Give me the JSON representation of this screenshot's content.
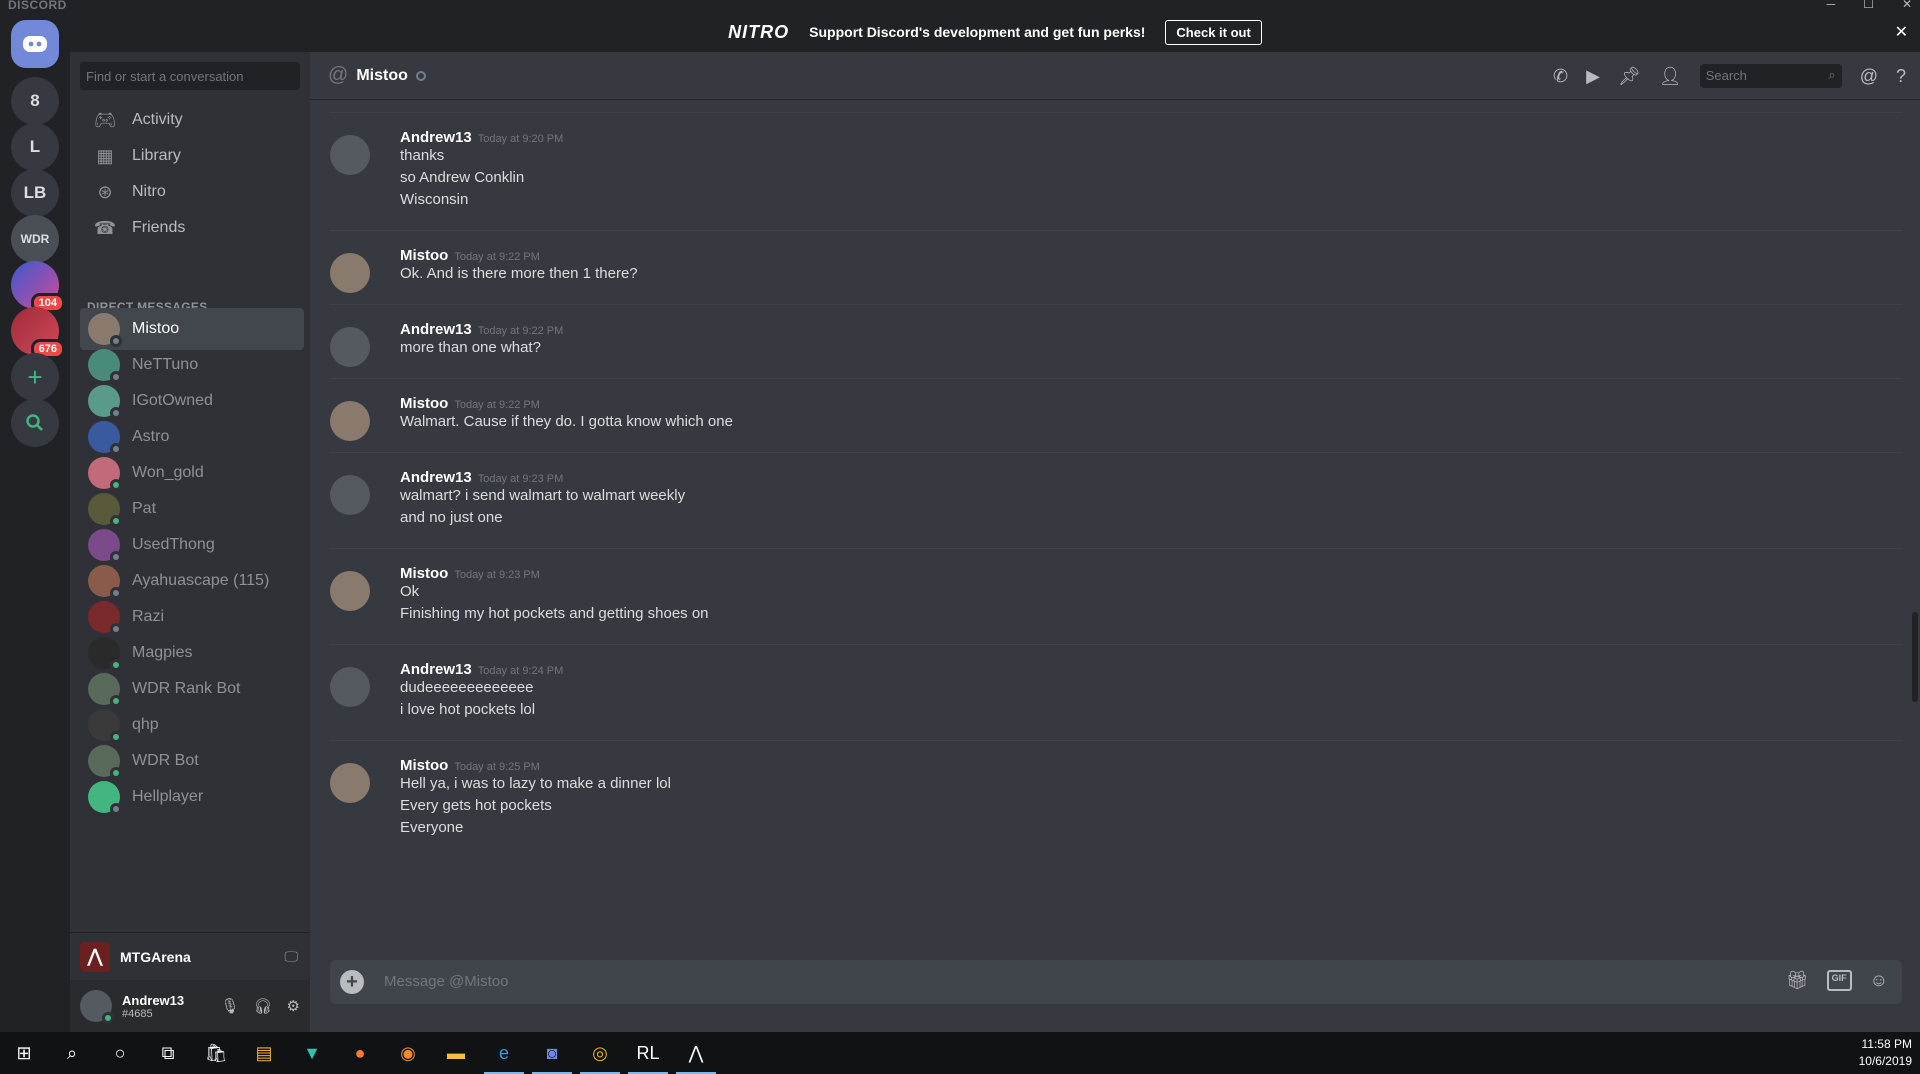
{
  "app": {
    "brand": "DISCORD"
  },
  "nitro": {
    "logo": "NITRO",
    "message": "Support Discord's development and get fun perks!",
    "cta": "Check it out"
  },
  "guilds": [
    {
      "label": "8"
    },
    {
      "label": "L"
    },
    {
      "label": "LB"
    },
    {
      "label": "WDR"
    },
    {
      "label": "",
      "badge": "104"
    },
    {
      "label": "",
      "badge": "676"
    }
  ],
  "sidebar": {
    "search_placeholder": "Find or start a conversation",
    "nav": [
      {
        "label": "Activity",
        "icon": "gamepad-icon"
      },
      {
        "label": "Library",
        "icon": "library-icon"
      },
      {
        "label": "Nitro",
        "icon": "nitro-icon"
      },
      {
        "label": "Friends",
        "icon": "friends-icon"
      }
    ],
    "dm_header": "DIRECT MESSAGES",
    "dms": [
      {
        "name": "Mistoo",
        "color": "#8a7a6e",
        "status": "offline"
      },
      {
        "name": "NeTTuno",
        "color": "#4a8a7a",
        "status": "offline"
      },
      {
        "name": "IGotOwned",
        "color": "#5a9a8a",
        "status": "offline"
      },
      {
        "name": "Astro",
        "color": "#3a5aa0",
        "status": "offline"
      },
      {
        "name": "Won_gold",
        "color": "#c06a7a",
        "status": "online"
      },
      {
        "name": "Pat",
        "color": "#5a5a3a",
        "status": "online"
      },
      {
        "name": "UsedThong",
        "color": "#7a4a8a",
        "status": "offline"
      },
      {
        "name": "Ayahuascape (115)",
        "color": "#8a5a4a",
        "status": "offline"
      },
      {
        "name": "Razi",
        "color": "#7a2a2a",
        "status": "offline"
      },
      {
        "name": "Magpies",
        "color": "#2a2a2a",
        "status": "online"
      },
      {
        "name": "WDR Rank Bot",
        "color": "#5a6a5a",
        "status": "online"
      },
      {
        "name": "qhp",
        "color": "#3a3a3a",
        "status": "online"
      },
      {
        "name": "WDR Bot",
        "color": "#5a6a5a",
        "status": "online"
      },
      {
        "name": "Hellplayer",
        "color": "#43b581",
        "status": "offline"
      }
    ],
    "game": {
      "name": "MTGArena"
    },
    "user": {
      "name": "Andrew13",
      "tag": "#4685"
    }
  },
  "chat": {
    "title": "Mistoo",
    "search_placeholder": "Search",
    "input_placeholder": "Message @Mistoo",
    "messages": [
      {
        "author": "Andrew13",
        "time": "Today at 9:20 PM",
        "lines": [
          "thanks",
          "so Andrew Conklin",
          "Wisconsin"
        ]
      },
      {
        "author": "Mistoo",
        "time": "Today at 9:22 PM",
        "lines": [
          "Ok. And is there more then 1 there?"
        ]
      },
      {
        "author": "Andrew13",
        "time": "Today at 9:22 PM",
        "lines": [
          "more than one what?"
        ]
      },
      {
        "author": "Mistoo",
        "time": "Today at 9:22 PM",
        "lines": [
          "Walmart. Cause if they do. I gotta know which one"
        ]
      },
      {
        "author": "Andrew13",
        "time": "Today at 9:23 PM",
        "lines": [
          "walmart? i send walmart to walmart weekly",
          "and no just one"
        ]
      },
      {
        "author": "Mistoo",
        "time": "Today at 9:23 PM",
        "lines": [
          "Ok",
          "Finishing my hot pockets and getting shoes on"
        ]
      },
      {
        "author": "Andrew13",
        "time": "Today at 9:24 PM",
        "lines": [
          "dudeeeeeeeeeeeee",
          "i love hot pockets lol"
        ]
      },
      {
        "author": "Mistoo",
        "time": "Today at 9:25 PM",
        "lines": [
          "Hell ya, i was to lazy to make a dinner lol",
          "Every gets hot pockets",
          "Everyone"
        ]
      }
    ]
  },
  "taskbar": {
    "time": "11:58 PM",
    "date": "10/6/2019"
  }
}
